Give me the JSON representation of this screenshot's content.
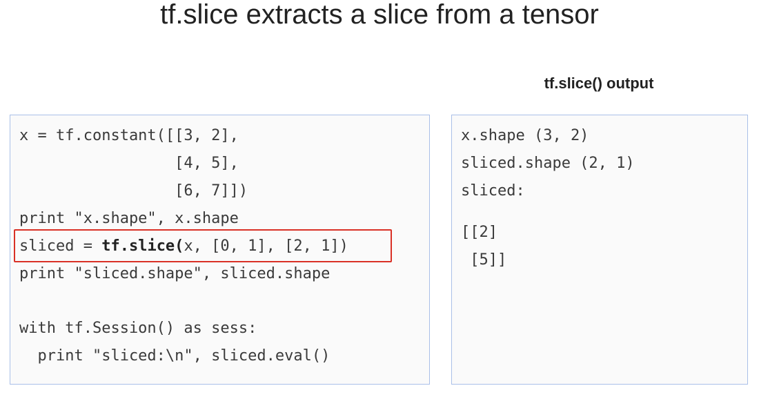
{
  "slide": {
    "title": "tf.slice extracts a slice from a tensor"
  },
  "code_panel": {
    "lines": [
      "x = tf.constant([[3, 2],",
      "                 [4, 5],",
      "                 [6, 7]])",
      "print \"x.shape\", x.shape",
      "print \"sliced.shape\", sliced.shape",
      "with tf.Session() as sess:",
      "  print \"sliced:\\n\", sliced.eval()"
    ],
    "highlighted_line": {
      "prefix": "sliced = ",
      "bold": "tf.slice(",
      "suffix": "x, [0, 1], [2, 1])"
    },
    "highlight_color": "#d93025"
  },
  "output_panel": {
    "heading": "tf.slice() output",
    "lines": [
      "x.shape (3, 2)",
      "sliced.shape (2, 1)",
      "sliced:",
      "[[2]",
      " [5]]"
    ]
  },
  "colors": {
    "panel_border": "#a9bfe8",
    "panel_background": "#fafafa"
  }
}
